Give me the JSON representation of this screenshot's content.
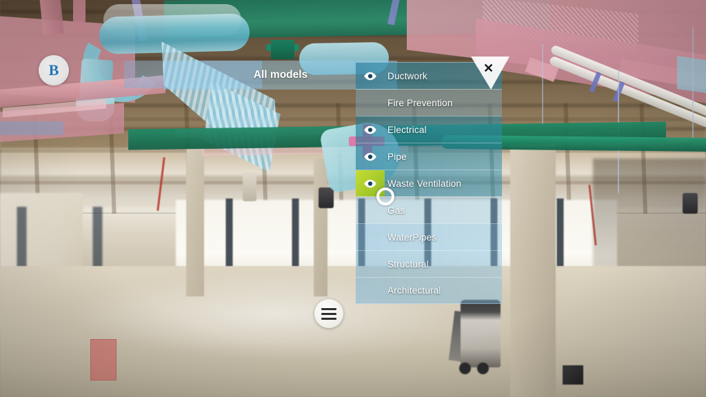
{
  "app": {
    "title": "All models",
    "marker_badge": "B"
  },
  "overlay_label": {
    "text": "All models"
  },
  "close_button": {
    "glyph": "✕",
    "name": "close-panel"
  },
  "cursor": {
    "type": "gaze-ring"
  },
  "menu_button": {
    "icon": "hamburger-icon"
  },
  "layer_panel": {
    "title": "All models",
    "eye_icon_name": "eye-icon",
    "highlight_color": "#a8cc2c",
    "rows": [
      {
        "label": "Ductwork",
        "visible": true,
        "selected": false,
        "bright": false
      },
      {
        "label": "Fire Prevention",
        "visible": false,
        "selected": false,
        "bright": false
      },
      {
        "label": "Electrical",
        "visible": true,
        "selected": false,
        "bright": false
      },
      {
        "label": "Pipe",
        "visible": true,
        "selected": false,
        "bright": false
      },
      {
        "label": "Waste Ventilation",
        "visible": true,
        "selected": true,
        "bright": false
      },
      {
        "label": "Gas",
        "visible": false,
        "selected": false,
        "bright": false
      },
      {
        "label": "WaterPipes",
        "visible": false,
        "selected": false,
        "bright": true
      },
      {
        "label": "Structural",
        "visible": false,
        "selected": false,
        "bright": true
      },
      {
        "label": "Architectural",
        "visible": false,
        "selected": false,
        "bright": true
      }
    ]
  },
  "scene": {
    "description": "Augmented-reality BIM model overlay on a construction-site interior",
    "model_colors": {
      "ductwork_pink": "#de9ea8",
      "pipe_teal": "#78c4d4",
      "ceiling_green": "#1f7a5e",
      "floor_marker_red": "#ce7470"
    }
  }
}
